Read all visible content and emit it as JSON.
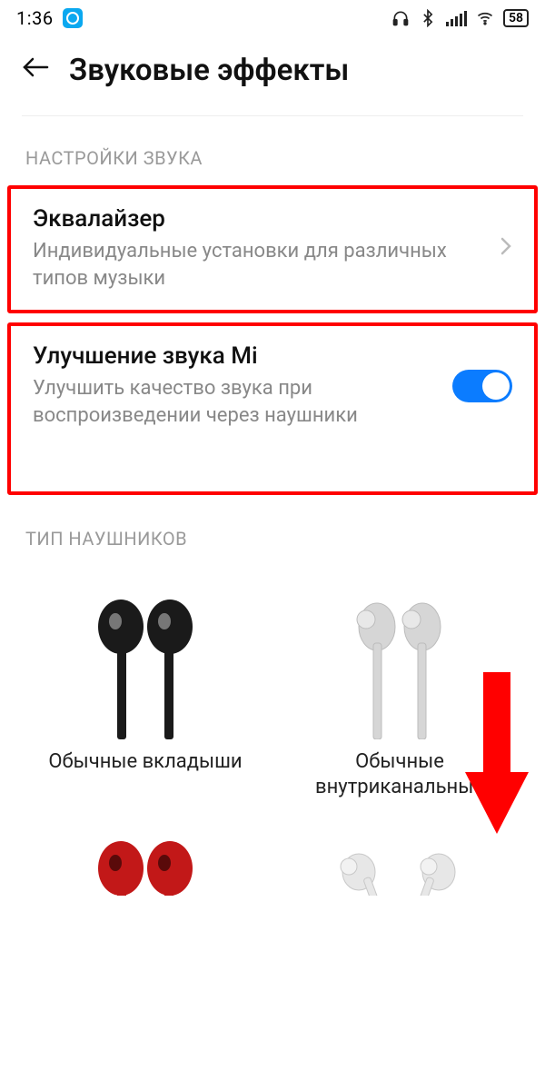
{
  "status": {
    "time": "1:36",
    "battery": "58"
  },
  "header": {
    "title": "Звуковые эффекты"
  },
  "section_sound": {
    "label": "НАСТРОЙКИ ЗВУКА",
    "equalizer": {
      "title": "Эквалайзер",
      "subtitle": "Индивидуальные установки для различных типов музыки"
    },
    "mi_sound": {
      "title": "Улучшение звука Mi",
      "subtitle": "Улучшить качество звука при воспроизведении через наушники",
      "enabled": true
    }
  },
  "section_headphones": {
    "label": "ТИП НАУШНИКОВ",
    "items": [
      {
        "label": "Обычные вкладыши"
      },
      {
        "label": "Обычные внутриканальные"
      }
    ]
  }
}
